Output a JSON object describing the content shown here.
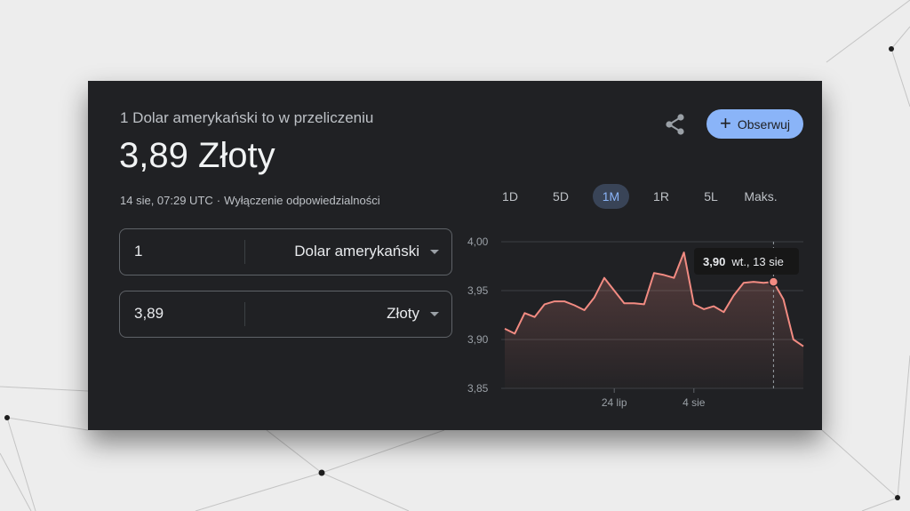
{
  "converter_card": {
    "subtitle": "1 Dolar amerykański to w przeliczeniu",
    "rate_text": "3,89 Złoty",
    "timestamp": "14 sie, 07:29 UTC",
    "separator": "·",
    "disclaimer": "Wyłączenie odpowiedzialności",
    "share_icon": "share-icon",
    "follow_button": {
      "icon": "plus-icon",
      "label": "Obserwuj"
    },
    "from": {
      "amount": "1",
      "currency": "Dolar amerykański"
    },
    "to": {
      "amount": "3,89",
      "currency": "Złoty"
    }
  },
  "time_ranges": [
    {
      "label": "1D",
      "active": false
    },
    {
      "label": "5D",
      "active": false
    },
    {
      "label": "1M",
      "active": true
    },
    {
      "label": "1R",
      "active": false
    },
    {
      "label": "5L",
      "active": false
    },
    {
      "label": "Maks.",
      "active": false
    }
  ],
  "chart_tooltip": {
    "value": "3,90",
    "date": "wt., 13 sie"
  },
  "colors": {
    "card_bg": "#202124",
    "accent_blue": "#8ab4f8",
    "line_red": "#f28b82"
  },
  "chart_data": {
    "type": "line",
    "ylim": [
      3.85,
      4.0
    ],
    "y_ticks": [
      "3,85",
      "3,90",
      "3,95",
      "4,00"
    ],
    "y_tick_values": [
      3.85,
      3.9,
      3.95,
      4.0
    ],
    "x_ticks": [
      {
        "label": "24 lip",
        "index": 11
      },
      {
        "label": "4 sie",
        "index": 19
      }
    ],
    "x_count": 29,
    "hover_index": 27,
    "series": [
      {
        "values": [
          3.911,
          3.906,
          3.927,
          3.923,
          3.936,
          3.939,
          3.939,
          3.935,
          3.93,
          3.943,
          3.963,
          3.95,
          3.937,
          3.937,
          3.936,
          3.968,
          3.966,
          3.963,
          3.989,
          3.936,
          3.931,
          3.934,
          3.928,
          3.945,
          3.958,
          3.959,
          3.958,
          3.959,
          3.941,
          3.9,
          3.893
        ]
      }
    ]
  }
}
